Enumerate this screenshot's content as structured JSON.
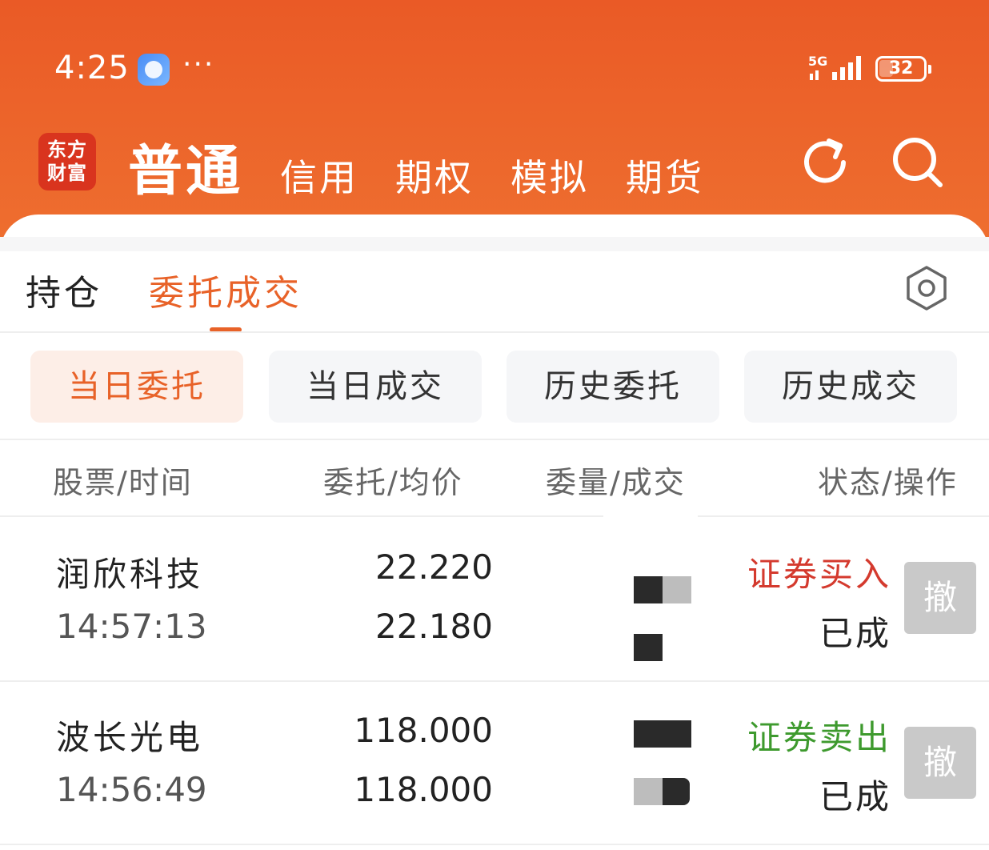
{
  "status_bar": {
    "time": "4:25",
    "more": "···",
    "network": "5G",
    "battery_level": 32,
    "battery_text": "32"
  },
  "colors": {
    "brand_orange": "#EA5A26",
    "accent": "#E86228",
    "buy_red": "#D43A2E",
    "sell_green": "#3E9A2E",
    "cancel_gray": "#c9c9c9"
  },
  "header": {
    "logo_line1": "东方",
    "logo_line2": "财富",
    "tabs": [
      "普通",
      "信用",
      "期权",
      "模拟",
      "期货"
    ],
    "active_tab": "普通",
    "icons": [
      "refresh-icon",
      "search-icon"
    ]
  },
  "subtabs": {
    "items": [
      "持仓",
      "委托成交"
    ],
    "active": "委托成交"
  },
  "filters": {
    "items": [
      "当日委托",
      "当日成交",
      "历史委托",
      "历史成交"
    ],
    "active": "当日委托"
  },
  "table": {
    "columns": [
      "股票/时间",
      "委托/均价",
      "委量/成交",
      "状态/操作"
    ],
    "rows": [
      {
        "name": "润欣科技",
        "time": "14:57:13",
        "order_price": "22.220",
        "avg_price": "22.180",
        "side": "证券买入",
        "status": "已成",
        "cancel": "撤"
      },
      {
        "name": "波长光电",
        "time": "14:56:49",
        "order_price": "118.000",
        "avg_price": "118.000",
        "side": "证券卖出",
        "status": "已成",
        "cancel": "撤"
      }
    ]
  }
}
